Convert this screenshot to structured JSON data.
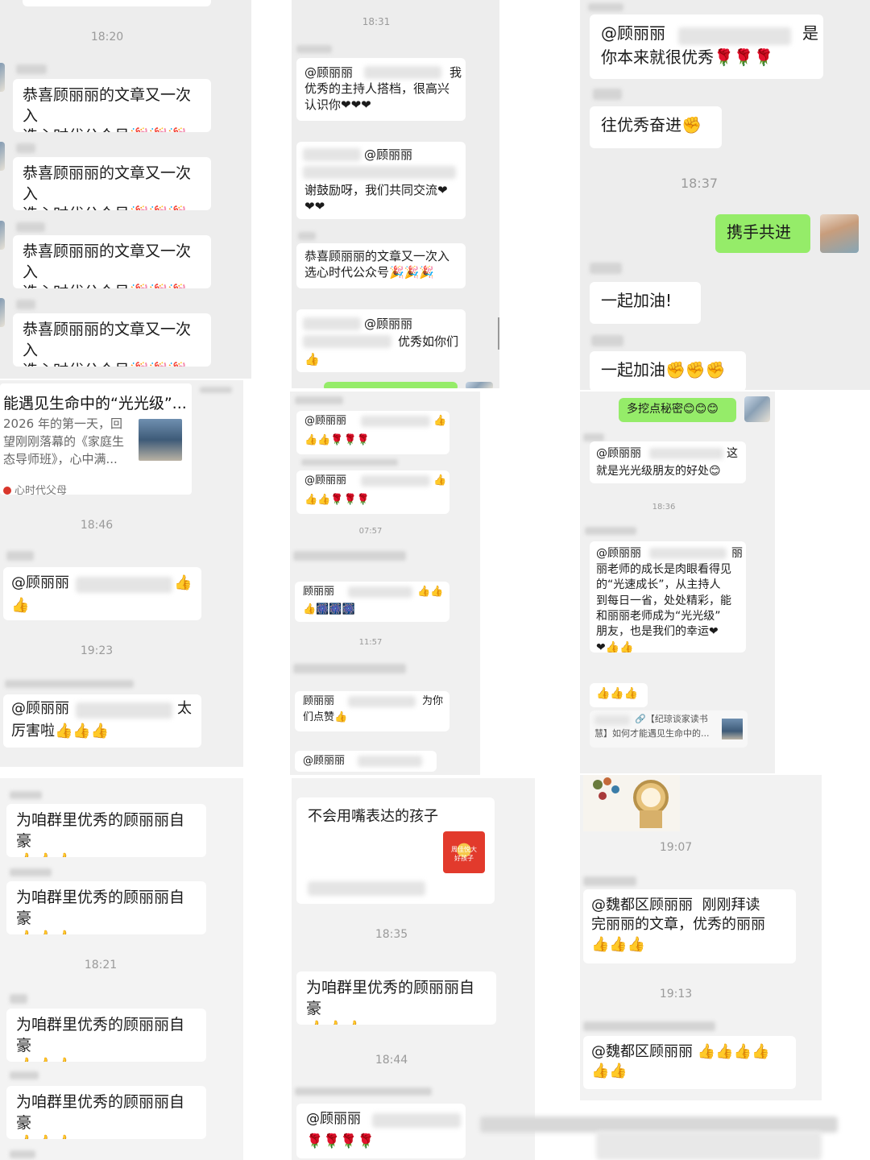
{
  "emoji": {
    "party": "🎉",
    "thumb": "👍",
    "heart": "❤",
    "rose": "🌹",
    "fist": "✊",
    "firework": "🎆",
    "smile": "😊"
  },
  "col1": {
    "top_ts": "18:20",
    "congrats_text": "恭喜顾丽丽的文章又一次入\n选心时代公众号🎉🎉🎉",
    "card": {
      "title": "能遇见生命中的“光光级”...",
      "desc": "2026 年的第一天，回望刚刚落幕的《家庭生态导师班》，心中满...",
      "source": "心时代父母"
    },
    "ts_1846": "18:46",
    "mention_1": "@顾丽丽",
    "mention_1_tail": "👍\n👍",
    "ts_1923": "19:23",
    "mention_2": "@顾丽丽",
    "mention_2_tail": "太",
    "mention_2_line2": "厉害啦👍👍👍",
    "proud_text": "为咱群里优秀的顾丽丽自豪\n👍👍👍",
    "ts_1821": "18:21"
  },
  "col2": {
    "ts_1831": "18:31",
    "msg_a_mention": "@顾丽丽",
    "msg_a_tail": "我",
    "msg_a_body": "优秀的主持人搭档，很高兴\n认识你❤❤❤",
    "msg_b_mention": "@顾丽丽",
    "msg_b_body": "谢鼓励呀，我们共同交流❤\n❤❤",
    "msg_c_body": "恭喜顾丽丽的文章又一次入\n选心时代公众号🎉🎉🎉",
    "msg_d_mention": "@顾丽丽",
    "msg_d_tail": "优秀如你们",
    "msg_d_line": "👍",
    "msg_e_mention": "@顾丽丽",
    "msg_e_line": "👍👍🌹🌹🌹",
    "msg_f_mention": "@顾丽丽",
    "msg_f_line": "👍👍🌹🌹🌹",
    "ts_0757": "07:57",
    "msg_g_name": "顾丽丽",
    "msg_g_line": "👍🎆🎆🎆",
    "ts_1157": "11:57",
    "msg_h_name": "顾丽丽",
    "msg_h_tail": "为你",
    "msg_h_line": "们点赞👍",
    "msg_i_mention": "@顾丽丽",
    "msg_j_text": "不会用嘴表达的孩子",
    "msg_j_image_text": "周佳悦大\n好孩子",
    "ts_1835": "18:35",
    "proud_text": "为咱群里优秀的顾丽丽自豪\n👍👍👍",
    "ts_1844": "18:44",
    "msg_k_mention": "@顾丽丽",
    "msg_k_line": "🌹🌹🌹🌹"
  },
  "col3": {
    "msg_a_mention": "@顾丽丽",
    "msg_a_tail": "是",
    "msg_a_body": "你本来就很优秀🌹🌹🌹",
    "msg_b": "往优秀奋进✊",
    "ts_1837": "18:37",
    "msg_c_self": "携手共进",
    "msg_d": "一起加油!",
    "msg_e": "一起加油✊✊✊",
    "msg_f_self": "多挖点秘密😊😊😊",
    "msg_g_mention": "@顾丽丽",
    "msg_g_tail": "这",
    "msg_g_body": "就是光光级朋友的好处😊",
    "ts_1836": "18:36",
    "msg_h_mention": "@顾丽丽",
    "msg_h_tail": "丽",
    "msg_h_body": "丽老师的成长是肉眼看得见\n的“光速成长”，从主持人\n到每日一省，处处精彩，能\n和丽丽老师成为“光光级”\n朋友，也是我们的幸运❤\n❤👍👍",
    "msg_i": "👍👍👍",
    "msg_j_link": "🔗【纪琼谈家读书",
    "msg_j_link2": "慧】如何才能遇见生命中的...",
    "ts_1907": "19:07",
    "msg_k": "@魏都区顾丽丽  刚刚拜读\n完丽丽的文章，优秀的丽丽\n👍👍👍",
    "ts_1913": "19:13",
    "msg_l": "@魏都区顾丽丽 👍👍👍👍\n👍👍"
  }
}
